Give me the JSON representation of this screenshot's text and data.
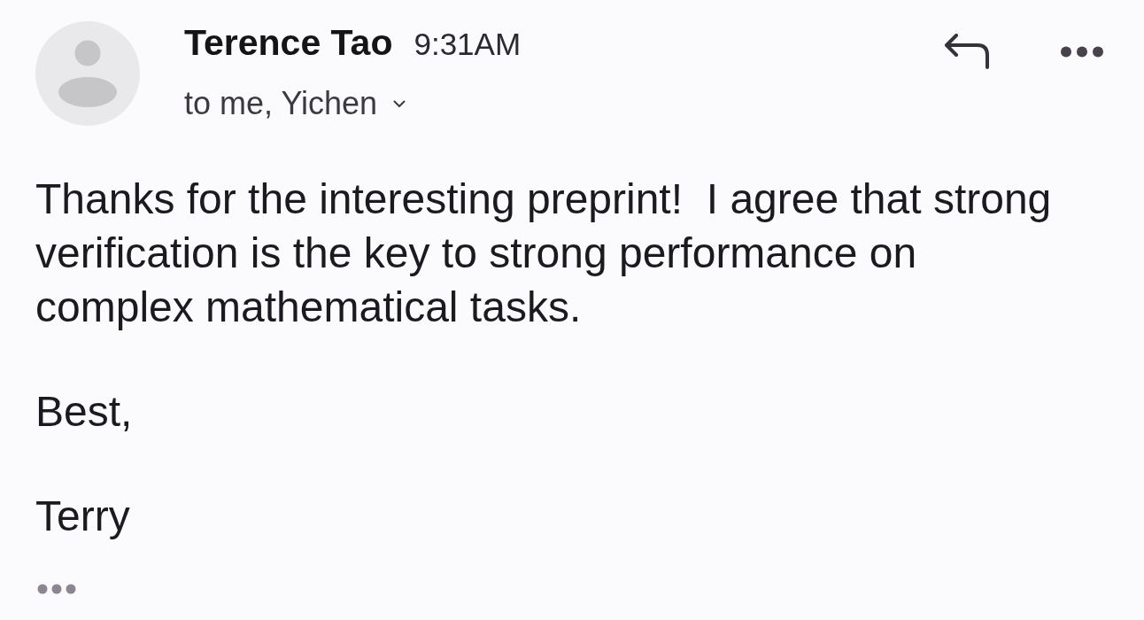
{
  "header": {
    "sender": "Terence Tao",
    "time": "9:31AM",
    "recipients": "to me, Yichen"
  },
  "body": {
    "paragraphs": [
      "Thanks for the interesting preprint!  I agree that strong\nverification is the key to strong performance on\ncomplex mathematical tasks.",
      "Best,",
      "Terry"
    ]
  }
}
